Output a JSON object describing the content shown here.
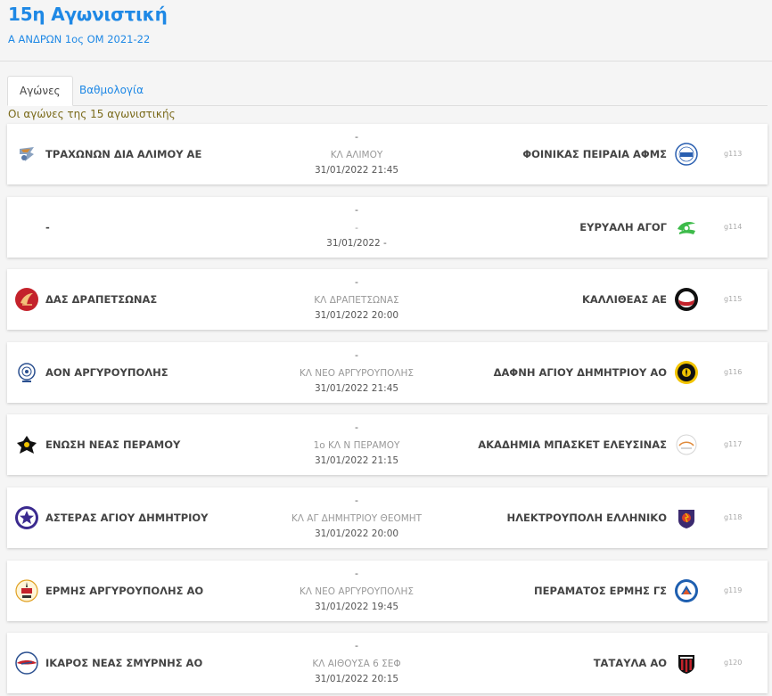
{
  "header": {
    "title": "15η Αγωνιστική",
    "subtitle": "Α ΑΝΔΡΩΝ 1ος ΟΜ 2021-22"
  },
  "tabs": [
    {
      "label": "Αγώνες",
      "active": true
    },
    {
      "label": "Βαθμολογία",
      "active": false
    }
  ],
  "round_caption": "Οι αγώνες της 15 αγωνιστικής",
  "colors": {
    "accent": "#1e88e5",
    "caption": "#7a6a1a",
    "background": "#f5f5f5"
  },
  "matches": [
    {
      "home": "ΤΡΑΧΩΝΩΝ ΔΙΑ ΑΛΙΜΟΥ ΑΕ",
      "home_logo": "trachones-logo",
      "score": "-",
      "venue": "ΚΛ ΑΛΙΜΟΥ",
      "datetime": "31/01/2022 21:45",
      "away": "ΦΟΙΝΙΚΑΣ ΠΕΙΡΑΙΑ ΑΦΜΣ",
      "away_logo": "foinikas-logo",
      "code": "g113"
    },
    {
      "home": "-",
      "home_logo": "",
      "score": "-",
      "venue": "-",
      "datetime": "31/01/2022 -",
      "away": "ΕΥΡΥΑΛΗ ΑΓΟΓ",
      "away_logo": "euryali-logo",
      "code": "g114"
    },
    {
      "home": "ΔΑΣ ΔΡΑΠΕΤΣΩΝΑΣ",
      "home_logo": "das-drapetsonas-logo",
      "score": "-",
      "venue": "ΚΛ ΔΡΑΠΕΤΣΩΝΑΣ",
      "datetime": "31/01/2022 20:00",
      "away": "ΚΑΛΛΙΘΕΑΣ ΑΕ",
      "away_logo": "kallitheas-logo",
      "code": "g115"
    },
    {
      "home": "ΑΟΝ ΑΡΓΥΡΟΥΠΟΛΗΣ",
      "home_logo": "aon-argyroupolis-logo",
      "score": "-",
      "venue": "ΚΛ ΝΕΟ ΑΡΓΥΡΟΥΠΟΛΗΣ",
      "datetime": "31/01/2022 21:45",
      "away": "ΔΑΦΝΗ ΑΓΙΟΥ ΔΗΜΗΤΡΙΟΥ ΑΟ",
      "away_logo": "dafni-logo",
      "code": "g116"
    },
    {
      "home": "ΕΝΩΣΗ ΝΕΑΣ ΠΕΡΑΜΟΥ",
      "home_logo": "enosi-peramou-logo",
      "score": "-",
      "venue": "1ο ΚΛ Ν ΠΕΡΑΜΟΥ",
      "datetime": "31/01/2022 21:15",
      "away": "ΑΚΑΔΗΜΙΑ ΜΠΑΣΚΕΤ ΕΛΕΥΣΙΝΑΣ",
      "away_logo": "akadimia-elefsinas-logo",
      "code": "g117"
    },
    {
      "home": "ΑΣΤΕΡΑΣ ΑΓΙΟΥ ΔΗΜΗΤΡΙΟΥ",
      "home_logo": "asteras-logo",
      "score": "-",
      "venue": "ΚΛ ΑΓ ΔΗΜΗΤΡΙΟΥ ΘΕΟΜΗΤ",
      "datetime": "31/01/2022 20:00",
      "away": "ΗΛΕΚΤΡΟΥΠΟΛΗ ΕΛΛΗΝΙΚΟ",
      "away_logo": "ilektroupoli-logo",
      "code": "g118"
    },
    {
      "home": "ΕΡΜΗΣ ΑΡΓΥΡΟΥΠΟΛΗΣ ΑΟ",
      "home_logo": "ermis-argyroupolis-logo",
      "score": "-",
      "venue": "ΚΛ ΝΕΟ ΑΡΓΥΡΟΥΠΟΛΗΣ",
      "datetime": "31/01/2022 19:45",
      "away": "ΠΕΡΑΜΑΤΟΣ ΕΡΜΗΣ ΓΣ",
      "away_logo": "peramatos-ermis-logo",
      "code": "g119"
    },
    {
      "home": "ΙΚΑΡΟΣ ΝΕΑΣ ΣΜΥΡΝΗΣ ΑΟ",
      "home_logo": "ikaros-logo",
      "score": "-",
      "venue": "ΚΛ ΑΙΘΟΥΣΑ 6 ΣΕΦ",
      "datetime": "31/01/2022 20:15",
      "away": "ΤΑΤΑΥΛΑ ΑΟ",
      "away_logo": "tatavla-logo",
      "code": "g120"
    }
  ]
}
